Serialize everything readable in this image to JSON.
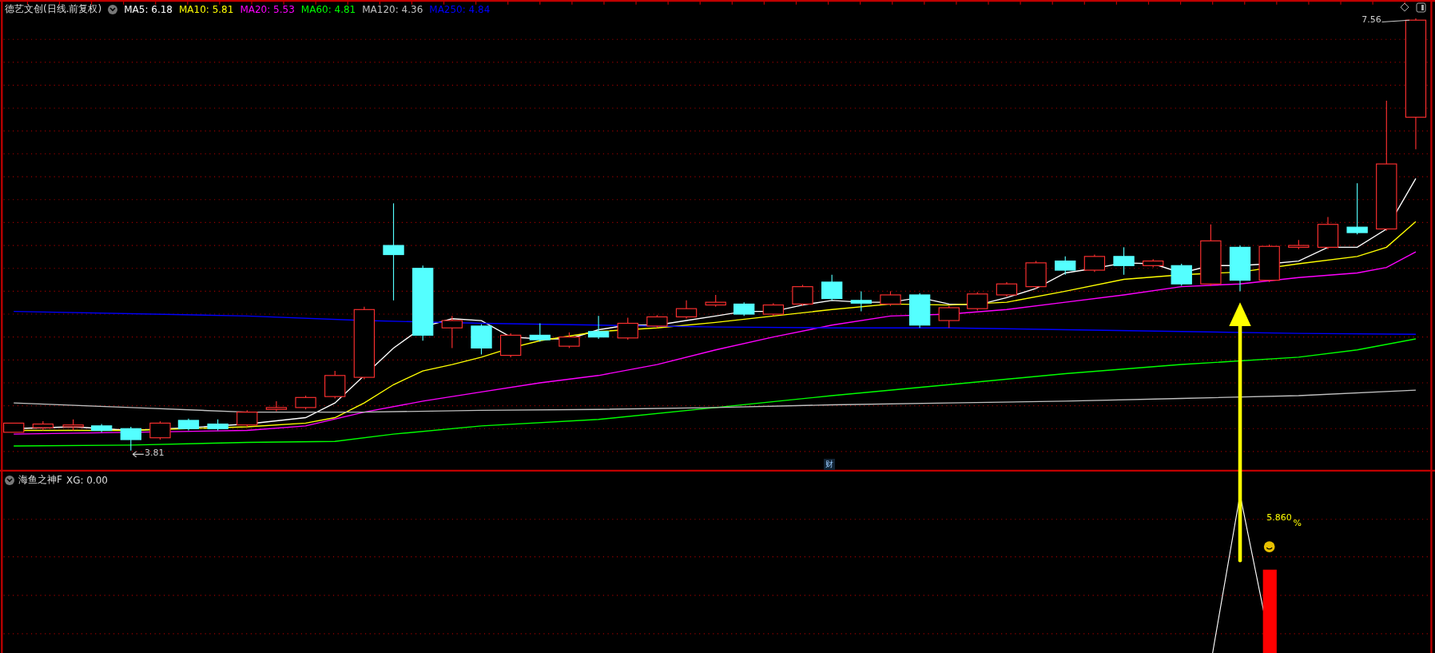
{
  "header": {
    "title": "德艺文创(日线.前复权)",
    "indicators": [
      {
        "label": "MA5: 6.18",
        "color": "#ffffff"
      },
      {
        "label": "MA10: 5.81",
        "color": "#ffff00"
      },
      {
        "label": "MA20: 5.53",
        "color": "#ff00ff"
      },
      {
        "label": "MA60: 4.81",
        "color": "#00ff00"
      },
      {
        "label": "MA120: 4.36",
        "color": "#c0c0c0"
      },
      {
        "label": "MA250: 4.84",
        "color": "#0000ff"
      }
    ]
  },
  "price_chart": {
    "high_label": "7.56",
    "low_label": "3.81",
    "marker": "财"
  },
  "sub_chart": {
    "title": "海鱼之神F",
    "reading": "XG: 0.00",
    "value_label": "5.860",
    "unit": "%"
  }
}
